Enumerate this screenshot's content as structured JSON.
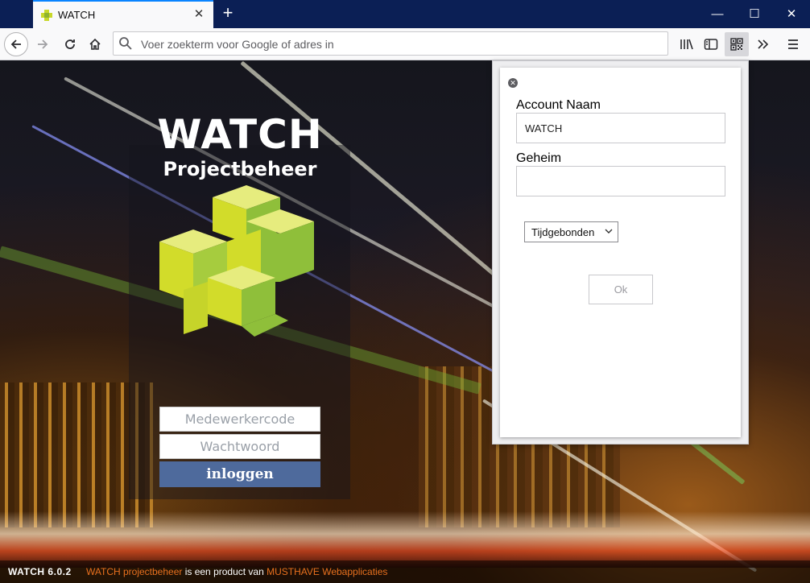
{
  "browser": {
    "tab_title": "WATCH",
    "tab_close_symbol": "✕",
    "new_tab_symbol": "+",
    "window_min_symbol": "—",
    "window_max_symbol": "☐",
    "window_close_symbol": "✕",
    "url_placeholder": "Voer zoekterm voor Google of adres in",
    "icons": [
      "back-icon",
      "forward-icon",
      "reload-icon",
      "home-icon",
      "search-icon",
      "library-icon",
      "sidebar-icon",
      "qr-extension-icon",
      "overflow-icon",
      "menu-icon"
    ]
  },
  "login": {
    "title": "WATCH",
    "subtitle": "Projectbeheer",
    "employee_placeholder": "Medewerkercode",
    "password_placeholder": "Wachtwoord",
    "submit_label": "inloggen"
  },
  "footer": {
    "version": "WATCH 6.0.2",
    "product_link": "WATCH projectbeheer",
    "middle_text": " is een product van ",
    "company_link": "MUSTHAVE Webapplicaties"
  },
  "popup": {
    "account_label": "Account Naam",
    "account_value": "WATCH",
    "secret_label": "Geheim",
    "secret_value": "",
    "type_select_value": "Tijdgebonden",
    "ok_label": "Ok"
  },
  "colors": {
    "tabbar": "#0b1f55",
    "login_button": "#4e6a9c",
    "footer_accent": "#e8701e",
    "logo_green": "#c8d82a"
  }
}
